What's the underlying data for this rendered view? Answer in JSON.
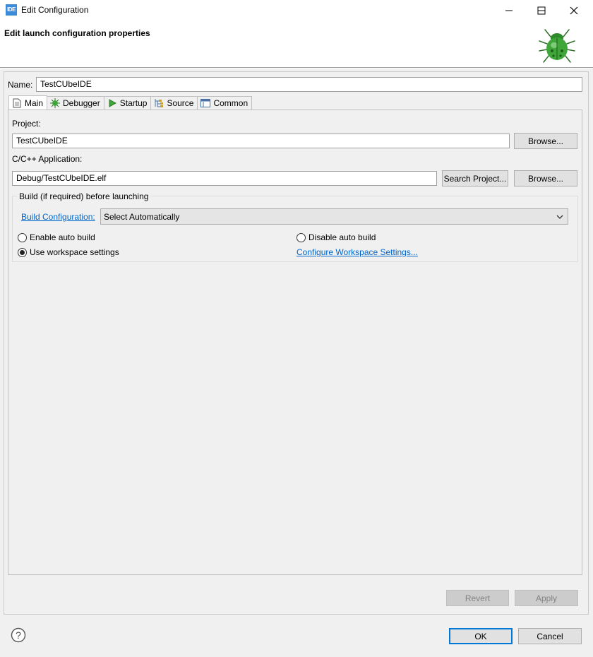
{
  "window": {
    "app_icon_text": "IDE",
    "title": "Edit Configuration"
  },
  "header": {
    "title": "Edit launch configuration properties"
  },
  "name_field": {
    "label": "Name:",
    "value": "TestCUbeIDE"
  },
  "tabs": [
    {
      "label": "Main",
      "icon": "page-icon",
      "active": true
    },
    {
      "label": "Debugger",
      "icon": "bug-gear-icon",
      "active": false
    },
    {
      "label": "Startup",
      "icon": "play-icon",
      "active": false
    },
    {
      "label": "Source",
      "icon": "source-icon",
      "active": false
    },
    {
      "label": "Common",
      "icon": "window-icon",
      "active": false
    }
  ],
  "main": {
    "project_label": "Project:",
    "project_value": "TestCUbeIDE",
    "project_browse": "Browse...",
    "app_label": "C/C++ Application:",
    "app_value": "Debug/TestCUbeIDE.elf",
    "search_project": "Search Project...",
    "app_browse": "Browse...",
    "build_group": {
      "title": "Build (if required) before launching",
      "build_config_link": "Build Configuration:",
      "build_config_selected": "Select Automatically",
      "enable_auto_build": "Enable auto build",
      "disable_auto_build": "Disable auto build",
      "use_workspace": "Use workspace settings",
      "configure_workspace_link": "Configure Workspace Settings...",
      "selected_option": "use_workspace"
    }
  },
  "actions": {
    "revert": "Revert",
    "apply": "Apply",
    "ok": "OK",
    "cancel": "Cancel"
  },
  "colors": {
    "link": "#0066cc",
    "default_button_border": "#0078d7",
    "bug_green": "#3fa63a"
  }
}
